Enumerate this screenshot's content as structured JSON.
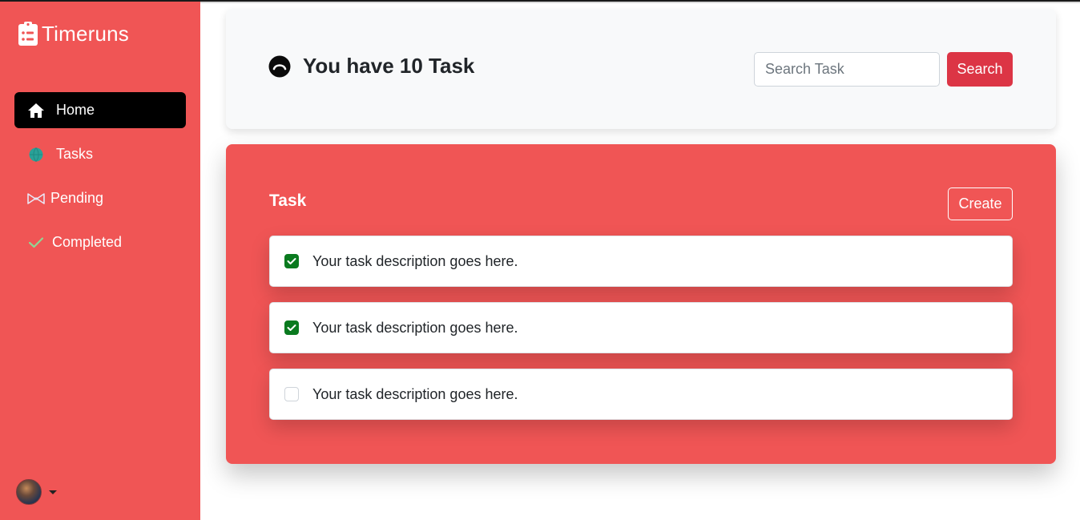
{
  "app": {
    "name": "Timeruns"
  },
  "sidebar": {
    "items": [
      {
        "label": "Home",
        "icon": "home-icon",
        "active": true
      },
      {
        "label": "Tasks",
        "icon": "globe-icon",
        "active": false
      },
      {
        "label": "Pending",
        "icon": "bowtie-icon",
        "active": false
      },
      {
        "label": "Completed",
        "icon": "check-icon",
        "active": false
      }
    ]
  },
  "header": {
    "title": "You have 10 Task",
    "search": {
      "placeholder": "Search Task",
      "value": ""
    },
    "search_button": "Search"
  },
  "tasks": {
    "title": "Task",
    "create_button": "Create",
    "items": [
      {
        "text": "Your task description goes here.",
        "checked": true
      },
      {
        "text": "Your task description goes here.",
        "checked": true
      },
      {
        "text": "Your task description goes here.",
        "checked": false
      }
    ]
  },
  "colors": {
    "sidebar_bg": "#f05555",
    "active_nav_bg": "#000000",
    "search_button": "#dc3545",
    "checkbox_checked": "#0a7a1f",
    "tasks_icon": "#2aa198",
    "completed_icon": "#8fd694"
  }
}
